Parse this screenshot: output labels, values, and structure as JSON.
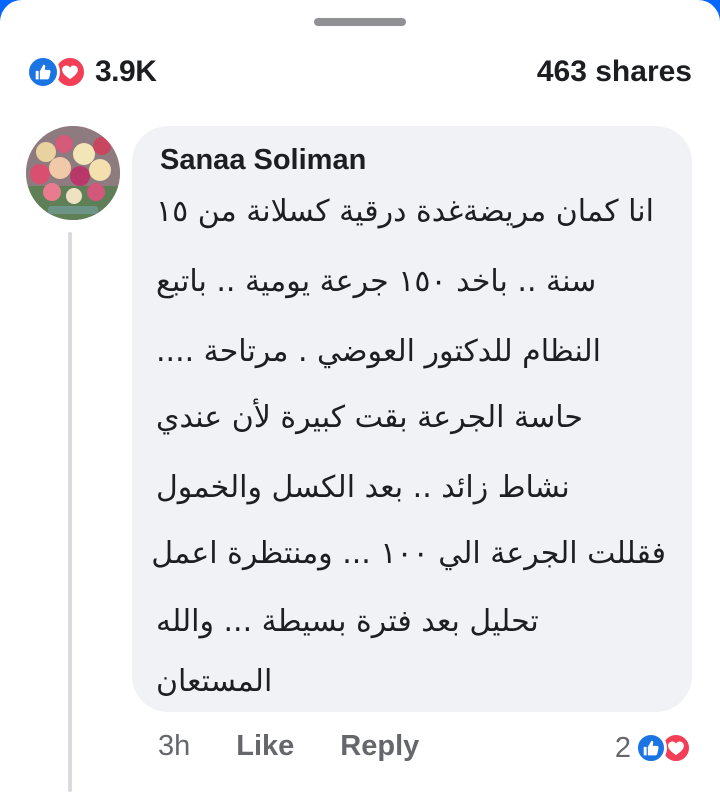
{
  "post": {
    "reaction_count": "3.9K",
    "shares_label": "463 shares",
    "reaction_types": [
      "like-icon",
      "love-icon"
    ]
  },
  "comment": {
    "author": "Sanaa Soliman",
    "lines": [
      "انا كمان مريضةغدة درقية كسلانة من ١٥",
      "سنة .. باخد ١٥٠ جرعة يومية .. باتبع",
      "النظام للدكتور العوضي . مرتاحة ....",
      "حاسة الجرعة بقت كبيرة لأن عندي",
      "نشاط زائد .. بعد الكسل والخمول",
      "فقللت الجرعة الي ١٠٠ ... ومنتظرة اعمل",
      "تحليل بعد فترة بسيطة ... والله",
      "المستعان"
    ],
    "time": "3h",
    "like_label": "Like",
    "reply_label": "Reply",
    "reaction_count": "2"
  },
  "colors": {
    "like_blue": "#1b74e4",
    "love_red": "#f33e58",
    "bubble_bg": "#f0f2f5",
    "meta_gray": "#65676b"
  }
}
